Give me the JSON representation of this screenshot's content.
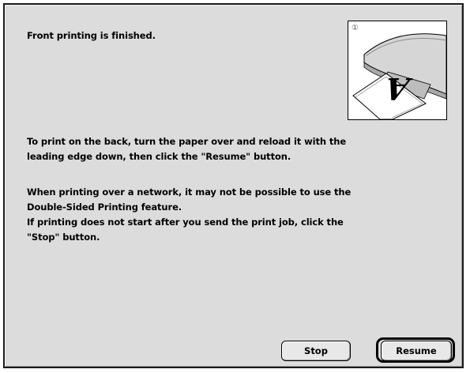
{
  "dialog": {
    "heading": "Front printing is finished.",
    "instructions_lines": [
      "To print on the back, turn the paper over and reload it with the",
      "leading edge down, then click the \"Resume\" button."
    ],
    "network_note_lines": [
      "When printing over a network, it may not be possible to use the",
      "Double-Sided Printing feature.",
      "If printing does not start after you send the print job, click the",
      "\"Stop\" button."
    ],
    "illustration": {
      "step_marker": "①",
      "paper_letter": "A"
    }
  },
  "buttons": {
    "stop_label": "Stop",
    "resume_label": "Resume"
  }
}
